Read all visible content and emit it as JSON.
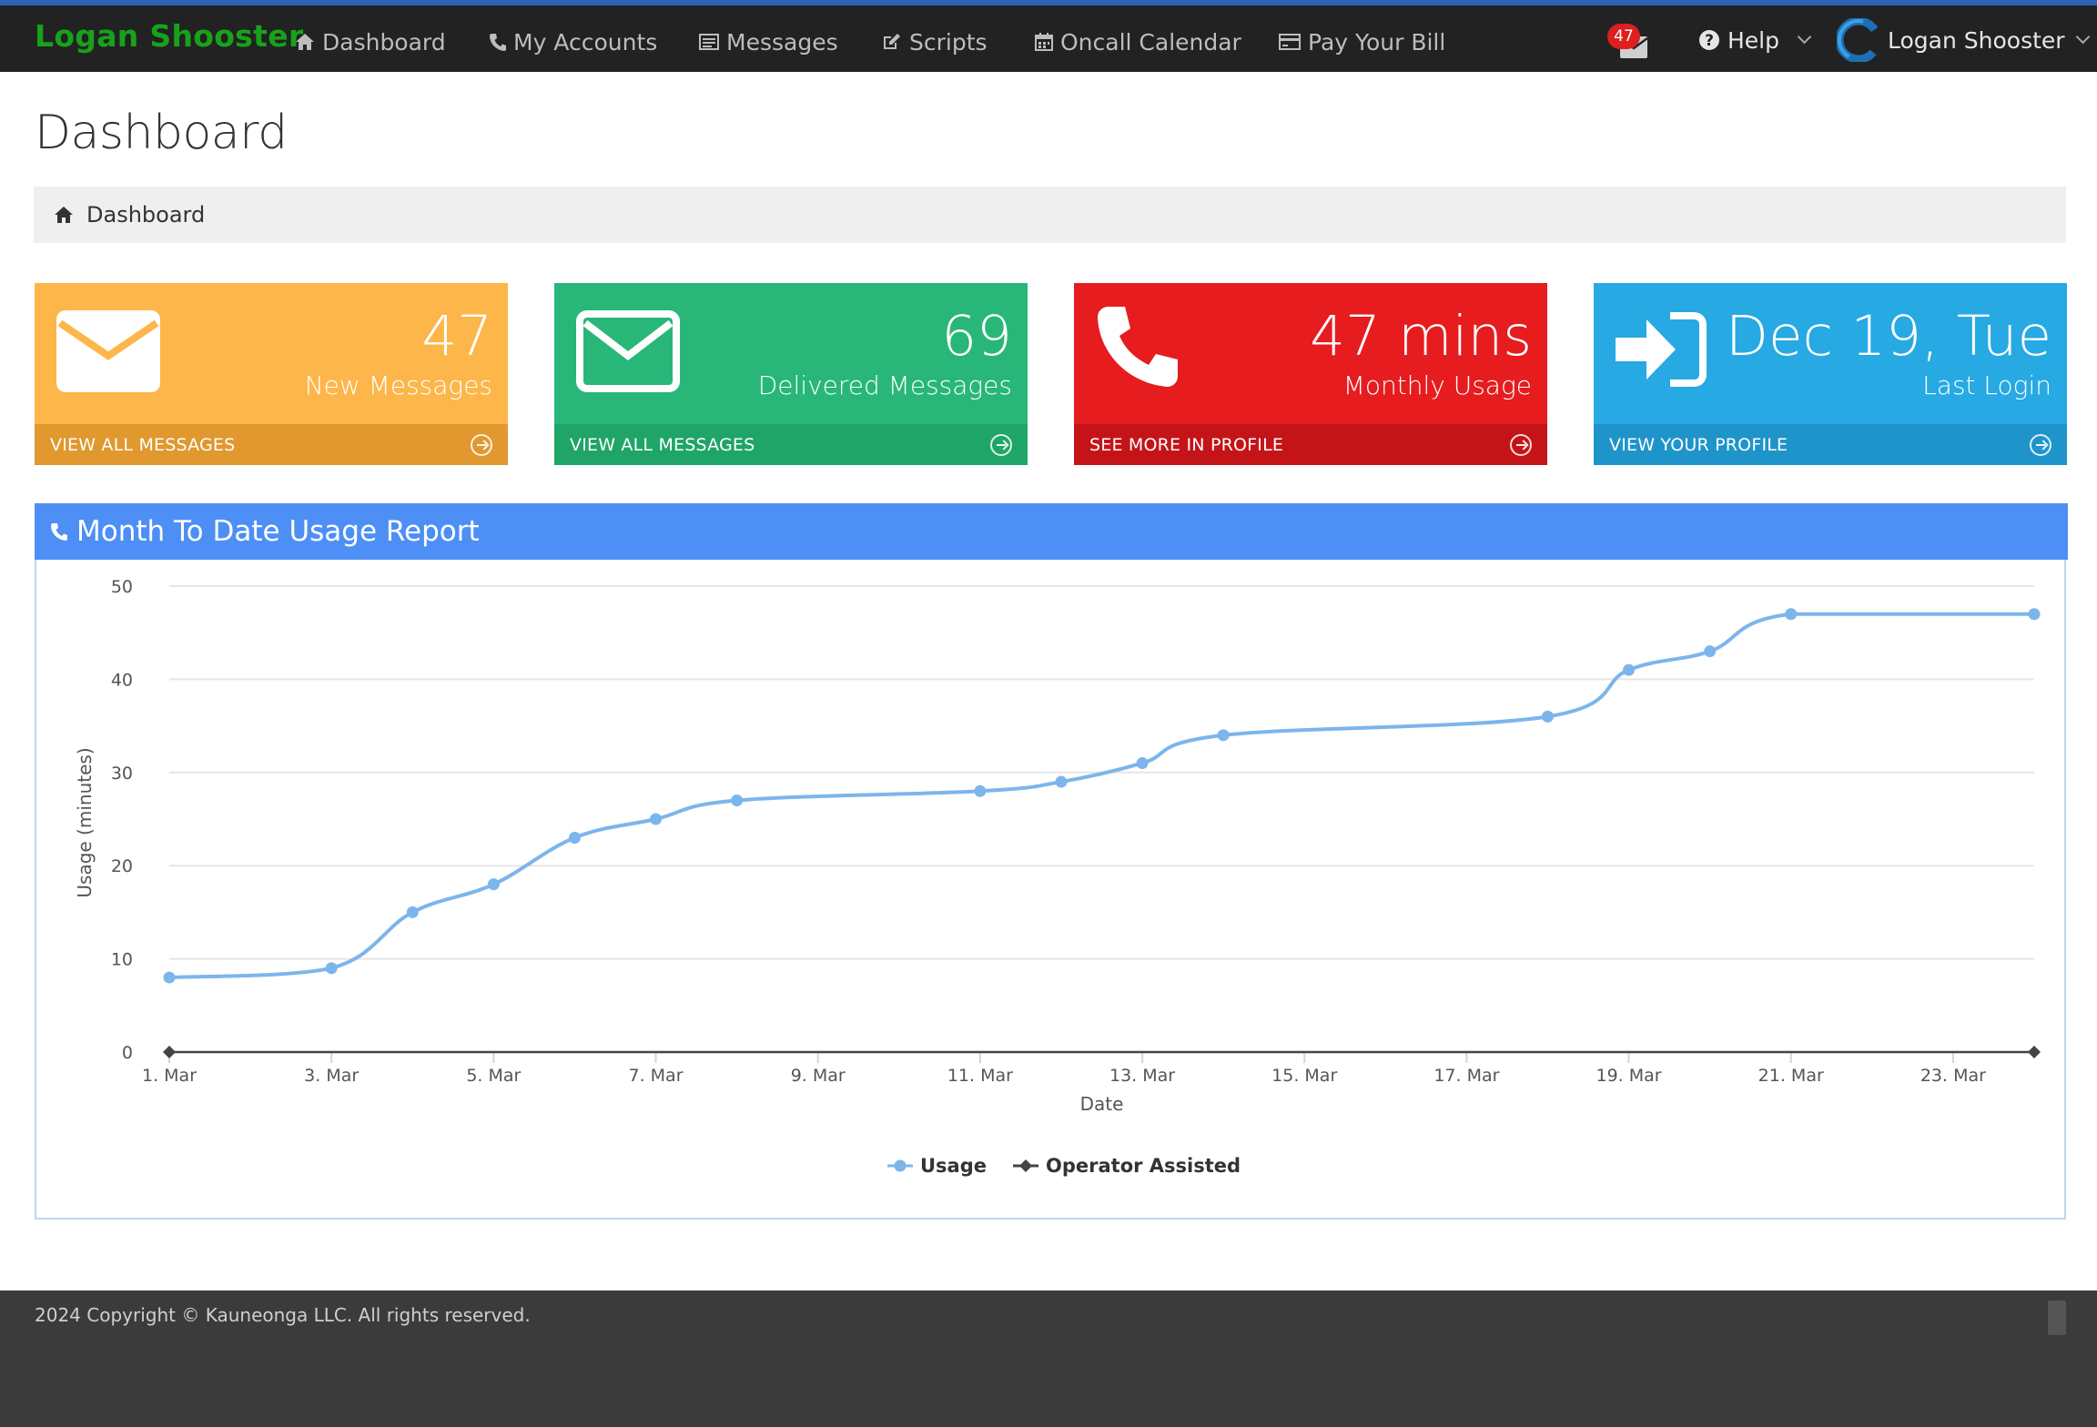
{
  "brand": "Logan Shooster",
  "nav": {
    "items": [
      {
        "label": "Dashboard",
        "icon": "home-icon"
      },
      {
        "label": "My Accounts",
        "icon": "phone-icon"
      },
      {
        "label": "Messages",
        "icon": "list-icon"
      },
      {
        "label": "Scripts",
        "icon": "edit-icon"
      },
      {
        "label": "Oncall Calendar",
        "icon": "calendar-icon"
      },
      {
        "label": "Pay Your Bill",
        "icon": "credit-card-icon"
      }
    ],
    "mail_badge": "47",
    "help_label": "Help",
    "user_name": "Logan Shooster"
  },
  "page": {
    "title": "Dashboard",
    "breadcrumb": "Dashboard"
  },
  "cards": [
    {
      "value": "47",
      "label": "New Messages",
      "footer": "VIEW ALL MESSAGES",
      "icon": "envelope-icon",
      "color": "#fdb64a"
    },
    {
      "value": "69",
      "label": "Delivered Messages",
      "footer": "VIEW ALL MESSAGES",
      "icon": "envelope-outline-icon",
      "color": "#28b779"
    },
    {
      "value": "47 mins",
      "label": "Monthly Usage",
      "footer": "SEE MORE IN PROFILE",
      "icon": "phone-icon",
      "color": "#e61c1f"
    },
    {
      "value": "Dec 19, Tue",
      "label": "Last Login",
      "footer": "VIEW YOUR PROFILE",
      "icon": "sign-in-icon",
      "color": "#27a9e3"
    }
  ],
  "panel": {
    "title": "Month To Date Usage Report"
  },
  "chart_data": {
    "type": "line",
    "xlabel": "Date",
    "ylabel": "Usage (minutes)",
    "ylim": [
      0,
      50
    ],
    "yticks": [
      0,
      10,
      20,
      30,
      40,
      50
    ],
    "xticks": [
      "1. Mar",
      "3. Mar",
      "5. Mar",
      "7. Mar",
      "9. Mar",
      "11. Mar",
      "13. Mar",
      "15. Mar",
      "17. Mar",
      "19. Mar",
      "21. Mar",
      "23. Mar"
    ],
    "xtick_days": [
      1,
      3,
      5,
      7,
      9,
      11,
      13,
      15,
      17,
      19,
      21,
      23
    ],
    "xlim": [
      1,
      24
    ],
    "grid": true,
    "legend_position": "bottom-center",
    "series": [
      {
        "name": "Usage",
        "color": "#7cb5ec",
        "marker": "circle",
        "points": [
          [
            1,
            8
          ],
          [
            3,
            9
          ],
          [
            4,
            15
          ],
          [
            5,
            18
          ],
          [
            6,
            23
          ],
          [
            7,
            25
          ],
          [
            8,
            27
          ],
          [
            11,
            28
          ],
          [
            12,
            29
          ],
          [
            13,
            31
          ],
          [
            14,
            34
          ],
          [
            18,
            36
          ],
          [
            19,
            41
          ],
          [
            20,
            43
          ],
          [
            21,
            47
          ],
          [
            24,
            47
          ]
        ]
      },
      {
        "name": "Operator Assisted",
        "color": "#434348",
        "marker": "diamond",
        "points": [
          [
            1,
            0
          ],
          [
            24,
            0
          ]
        ]
      }
    ]
  },
  "footer": {
    "copyright": "2024 Copyright © Kauneonga LLC. All rights reserved."
  }
}
